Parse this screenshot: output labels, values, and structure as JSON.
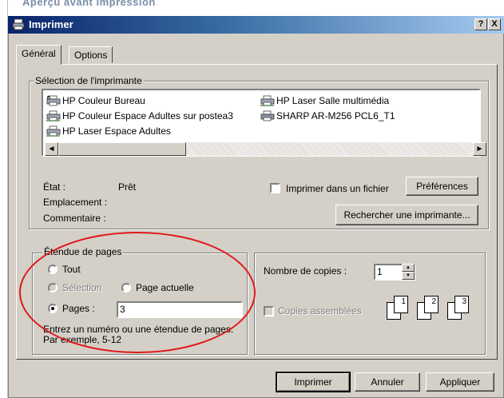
{
  "background": {
    "window_title": "Aperçu avant impression"
  },
  "dialog": {
    "title": "Imprimer",
    "help_button": "?",
    "close_button": "X",
    "tabs": [
      {
        "label": "Général",
        "active": true
      },
      {
        "label": "Options",
        "active": false
      }
    ]
  },
  "printer_selection": {
    "legend": "Sélection de l'imprimante",
    "printers": [
      {
        "name": "HP Couleur Bureau",
        "icon": "printer-default-icon",
        "selected": false
      },
      {
        "name": "HP Couleur Espace Adultes sur postea3",
        "icon": "printer-network-icon",
        "selected": false
      },
      {
        "name": "HP Laser Espace Adultes",
        "icon": "printer-network-icon",
        "selected": false
      },
      {
        "name": "HP Laser Salle multimédia",
        "icon": "printer-network-icon",
        "selected": false
      },
      {
        "name": "SHARP AR-M256 PCL6_T1",
        "icon": "printer-icon",
        "selected": false
      }
    ],
    "scroll_left": "◄",
    "scroll_right": "►",
    "status_label": "État :",
    "status_value": "Prêt",
    "location_label": "Emplacement :",
    "comment_label": "Commentaire :",
    "print_to_file_label": "Imprimer dans un fichier",
    "print_to_file_checked": false,
    "preferences_button": "Préférences",
    "find_printer_button": "Rechercher une imprimante..."
  },
  "page_range": {
    "legend": "Étendue de pages",
    "option_all": "Tout",
    "option_selection": "Sélection",
    "option_current_page": "Page actuelle",
    "option_pages": "Pages :",
    "selected_option": "Pages",
    "pages_value": "3",
    "hint_line1": "Entrez un numéro ou une étendue de pages.",
    "hint_line2": "Par exemple, 5-12"
  },
  "copies": {
    "count_label": "Nombre de copies :",
    "count_value": "1",
    "collate_label": "Copies assemblées",
    "collate_checked": false,
    "collate_enabled": false,
    "collate_pages": [
      "1",
      "1",
      "2",
      "2",
      "3",
      "3"
    ]
  },
  "buttons": {
    "print": "Imprimer",
    "cancel": "Annuler",
    "apply": "Appliquer"
  },
  "annotation_color": "#e01818"
}
